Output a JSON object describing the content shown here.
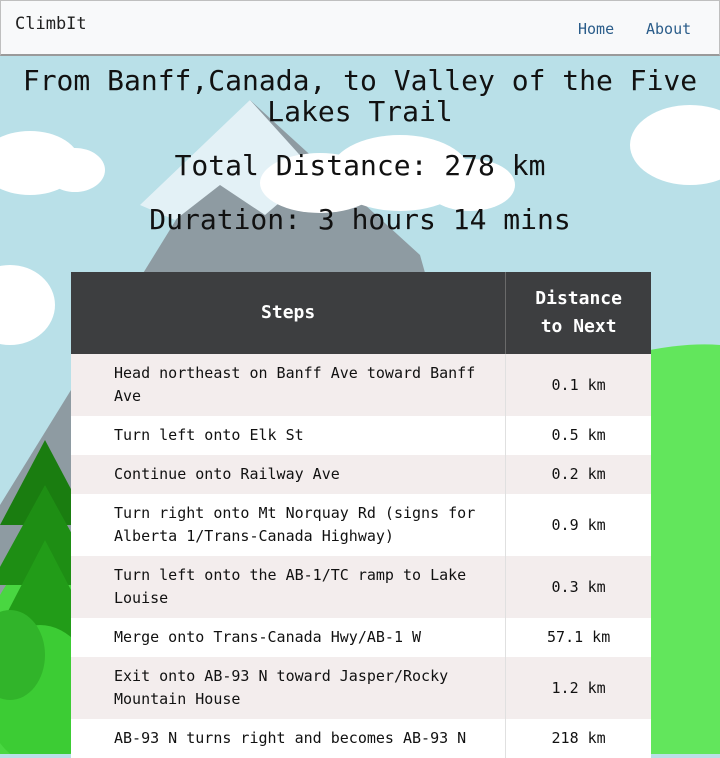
{
  "navbar": {
    "brand": "ClimbIt",
    "links": [
      "Home",
      "About"
    ]
  },
  "route": {
    "title": "From Banff,Canada, to Valley of the Five Lakes Trail",
    "total_distance": "Total Distance: 278 km",
    "duration": "Duration: 3 hours 14 mins"
  },
  "table": {
    "headers": [
      "Steps",
      "Distance to Next"
    ],
    "rows": [
      {
        "step": "Head northeast on Banff Ave toward Banff Ave",
        "distance": "0.1 km"
      },
      {
        "step": "Turn left onto Elk St",
        "distance": "0.5 km"
      },
      {
        "step": "Continue onto Railway Ave",
        "distance": "0.2 km"
      },
      {
        "step": "Turn right onto Mt Norquay Rd (signs for Alberta 1/Trans-Canada Highway)",
        "distance": "0.9 km"
      },
      {
        "step": "Turn left onto the AB-1/TC ramp to Lake Louise",
        "distance": "0.3 km"
      },
      {
        "step": "Merge onto Trans-Canada Hwy/AB-1 W",
        "distance": "57.1 km"
      },
      {
        "step": "Exit onto AB-93 N toward Jasper/Rocky Mountain House",
        "distance": "1.2 km"
      },
      {
        "step": "AB-93 N turns right and becomes AB-93 N",
        "distance": "218 km"
      }
    ]
  },
  "colors": {
    "sky": "#b9e0e8",
    "mountain": "#8e9ba2",
    "snow": "#e3f1f6",
    "grass": "#62e65c",
    "tree": "#1a7d10",
    "table_header": "#3d3e40",
    "row_odd": "#f3eded",
    "row_even": "#ffffff",
    "link": "#2b5d8a"
  }
}
